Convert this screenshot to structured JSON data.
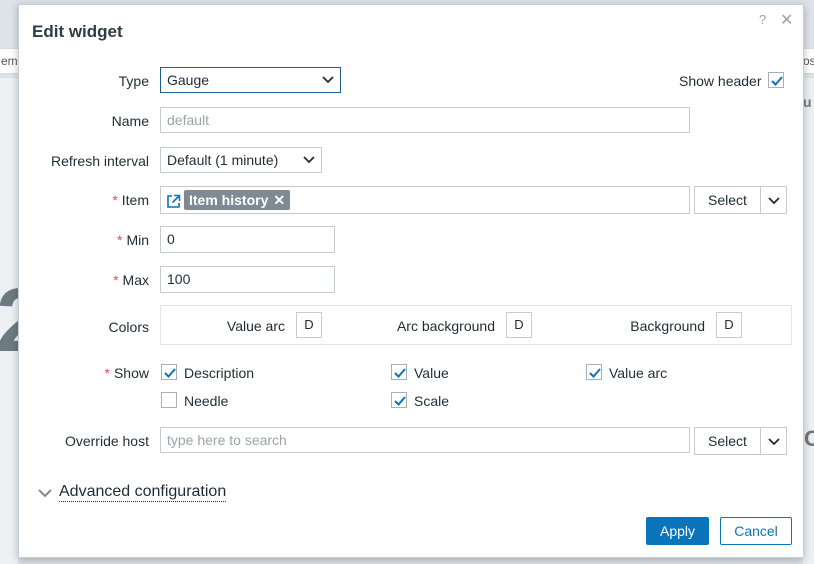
{
  "background": {
    "left_tab_text": "emN",
    "right_tab_text": "os",
    "big_digit": "2",
    "right_fragment": "u",
    "right_fragment2": "C"
  },
  "dialog": {
    "title": "Edit widget",
    "help": "?",
    "close": "✕"
  },
  "form": {
    "type_label": "Type",
    "type_value": "Gauge",
    "show_header_label": "Show header",
    "show_header_checked": true,
    "name_label": "Name",
    "name_placeholder": "default",
    "refresh_label": "Refresh interval",
    "refresh_value": "Default (1 minute)",
    "item_label": "Item",
    "item_tag": "Item history",
    "item_select": "Select",
    "min_label": "Min",
    "min_value": "0",
    "max_label": "Max",
    "max_value": "100",
    "colors_label": "Colors",
    "colors": [
      {
        "label": "Value arc",
        "button": "D"
      },
      {
        "label": "Arc background",
        "button": "D"
      },
      {
        "label": "Background",
        "button": "D"
      }
    ],
    "show_label": "Show",
    "show_options": [
      {
        "label": "Description",
        "checked": true
      },
      {
        "label": "Value",
        "checked": true
      },
      {
        "label": "Value arc",
        "checked": true
      },
      {
        "label": "Needle",
        "checked": false
      },
      {
        "label": "Scale",
        "checked": true
      }
    ],
    "override_label": "Override host",
    "override_placeholder": "type here to search",
    "override_select": "Select",
    "advanced": "Advanced configuration",
    "required_mark": "*"
  },
  "footer": {
    "apply": "Apply",
    "cancel": "Cancel"
  },
  "colors": {
    "primary": "#0b75bb",
    "required": "#d9534f",
    "tag": "#7e8b93"
  }
}
